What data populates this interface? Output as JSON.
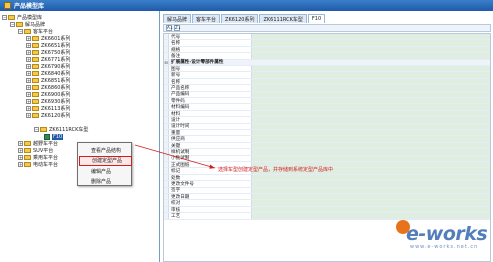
{
  "window": {
    "title": "产品模型库"
  },
  "tree": {
    "root": "产品模型库",
    "brand": "解马品牌",
    "platform": "客车平台",
    "series": [
      "ZK6601系列",
      "ZK6651系列",
      "ZK6750系列",
      "ZK6771系列",
      "ZK6790系列",
      "ZK6840系列",
      "ZK6851系列",
      "ZK6860系列",
      "ZK6900系列",
      "ZK6930系列",
      "ZK6113系列",
      "ZK6120系列"
    ],
    "subgroup": "ZK6111RCK车型",
    "selected_item": "F10",
    "platforms_other": [
      "越野车平台",
      "SUV平台",
      "乘用车平台",
      "电动车平台"
    ]
  },
  "context_menu": {
    "items": [
      "查看产品结构",
      "创建定型产品",
      "编辑产品",
      "删除产品"
    ],
    "highlighted_index": 1
  },
  "tabs": [
    "解马品牌",
    "客车平台",
    "ZK6120系列",
    "ZK6111RCK车型",
    "F10"
  ],
  "active_tab": 4,
  "toolbar": {
    "sort_az": "A↓",
    "sort_za": "Z↓"
  },
  "properties": {
    "section_header": "扩展属性-设计零部件属性",
    "section_toggle": "⊟",
    "rows_before": [
      "代号",
      "名称",
      "规格",
      "备注"
    ],
    "rows_after": [
      "图号",
      "新号",
      "名称",
      "产品名称",
      "产品编码",
      "零件码",
      "材料编码",
      "材料",
      "设计",
      "设计时间",
      "重量",
      "供应商",
      "关键",
      "样机试制",
      "小批试制",
      "正式图纸",
      "标记",
      "处数",
      "更改文件号",
      "签字",
      "更改日期",
      "校对",
      "审核",
      "工艺"
    ]
  },
  "annotation": {
    "text": "选择车型创建定型产品，并存储到系统定型产品库中",
    "color": "#d11f1f"
  },
  "watermark": {
    "brand": "e-works",
    "sub": "www.e-works.net.cn"
  },
  "colors": {
    "accent": "#1f5aa8",
    "highlight": "#d11f1f",
    "value_cell": "#dfeee0"
  }
}
